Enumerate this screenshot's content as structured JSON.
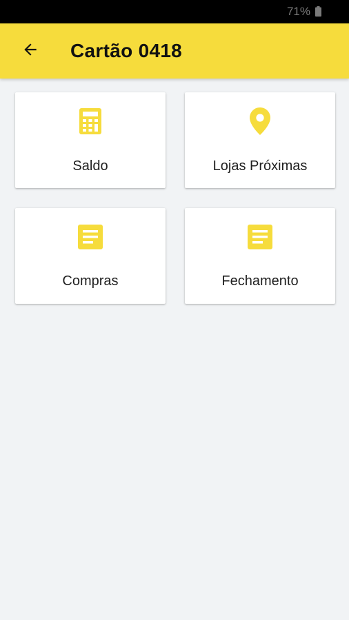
{
  "status_bar": {
    "battery_text": "71%",
    "battery_icon": "battery-icon"
  },
  "app_bar": {
    "title": "Cartão 0418",
    "back_icon": "arrow-back-icon",
    "background_color": "#F6DC3C"
  },
  "cards": [
    {
      "label": "Saldo",
      "icon": "calculator-icon"
    },
    {
      "label": "Lojas Próximas",
      "icon": "location-pin-icon"
    },
    {
      "label": "Compras",
      "icon": "document-icon"
    },
    {
      "label": "Fechamento",
      "icon": "document-icon"
    }
  ],
  "colors": {
    "accent": "#F6DC3C",
    "icon": "#F6DC3C",
    "background": "#F1F3F5",
    "card": "#FFFFFF",
    "text": "#212121"
  }
}
